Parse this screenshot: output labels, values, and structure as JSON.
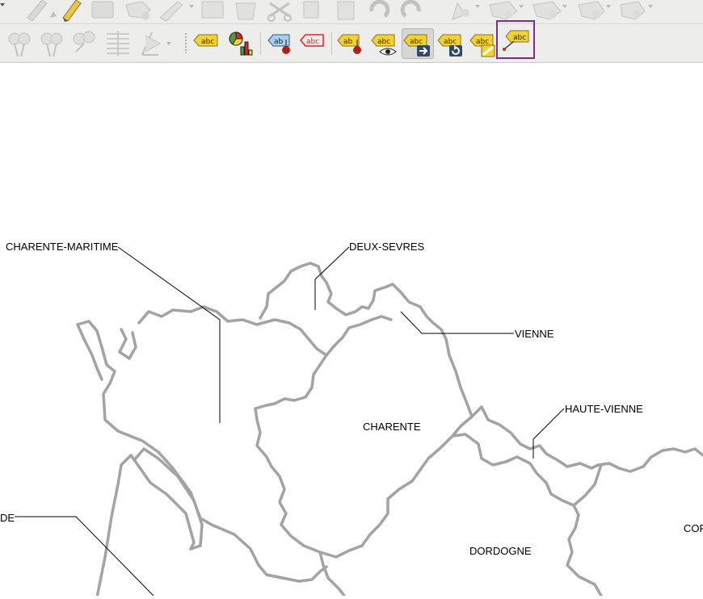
{
  "toolbar_top": {
    "icons": [
      "pencil-icon",
      "edit-pencil-icon",
      "save-layer-icon",
      "add-feature-icon",
      "digitize-icon",
      "modify-attributes-icon",
      "delete-icon",
      "cut-icon",
      "copy-icon",
      "paste-icon",
      "undo-icon",
      "redo-icon",
      "node-tool-icon",
      "add-ring-icon",
      "add-part-icon",
      "fill-ring-icon",
      "delete-ring-icon"
    ]
  },
  "toolbar_labels": {
    "buttons": [
      {
        "name": "pin-labels-button",
        "icon": "pin-icon"
      },
      {
        "name": "show-hide-labels-button",
        "icon": "show-hide-icon"
      },
      {
        "name": "move-label-button",
        "icon": "move-icon"
      },
      {
        "name": "rotate-label-button",
        "icon": "rotate-icon"
      },
      {
        "name": "change-label-button",
        "icon": "change-icon"
      },
      {
        "name": "label-tool-button",
        "label": "abc"
      },
      {
        "name": "diagram-tool-button",
        "icon": "diagram-icon"
      },
      {
        "name": "pin-unpin-labels-button",
        "label": "ab"
      },
      {
        "name": "highlight-pinned-labels-button",
        "label": "abc"
      },
      {
        "name": "pin-label-button",
        "label": "ab"
      },
      {
        "name": "show-hide-label-button",
        "label": "abc"
      },
      {
        "name": "move-label-tool-button",
        "label": "abc"
      },
      {
        "name": "rotate-label-tool-button",
        "label": "abc"
      },
      {
        "name": "change-label-properties-button",
        "label": "abc"
      },
      {
        "name": "move-callout-button",
        "label": "abc"
      }
    ]
  },
  "map": {
    "labels": [
      {
        "id": "charente-maritime",
        "text": "CHARENTE-MARITIME"
      },
      {
        "id": "deux-sevres",
        "text": "DEUX-SEVRES"
      },
      {
        "id": "vienne",
        "text": "VIENNE"
      },
      {
        "id": "haute-vienne",
        "text": "HAUTE-VIENNE"
      },
      {
        "id": "charente",
        "text": "CHARENTE"
      },
      {
        "id": "gironde",
        "text": "DE"
      },
      {
        "id": "dordogne",
        "text": "DORDOGNE"
      },
      {
        "id": "correze",
        "text": "COR"
      }
    ],
    "border_color": "#a0a0a0",
    "callout_color": "#000000"
  },
  "colors": {
    "toolbar_bg": "#ededec",
    "label_yellow": "#f2d230",
    "label_red": "#d9262b",
    "selection": "#7d2c8c"
  }
}
